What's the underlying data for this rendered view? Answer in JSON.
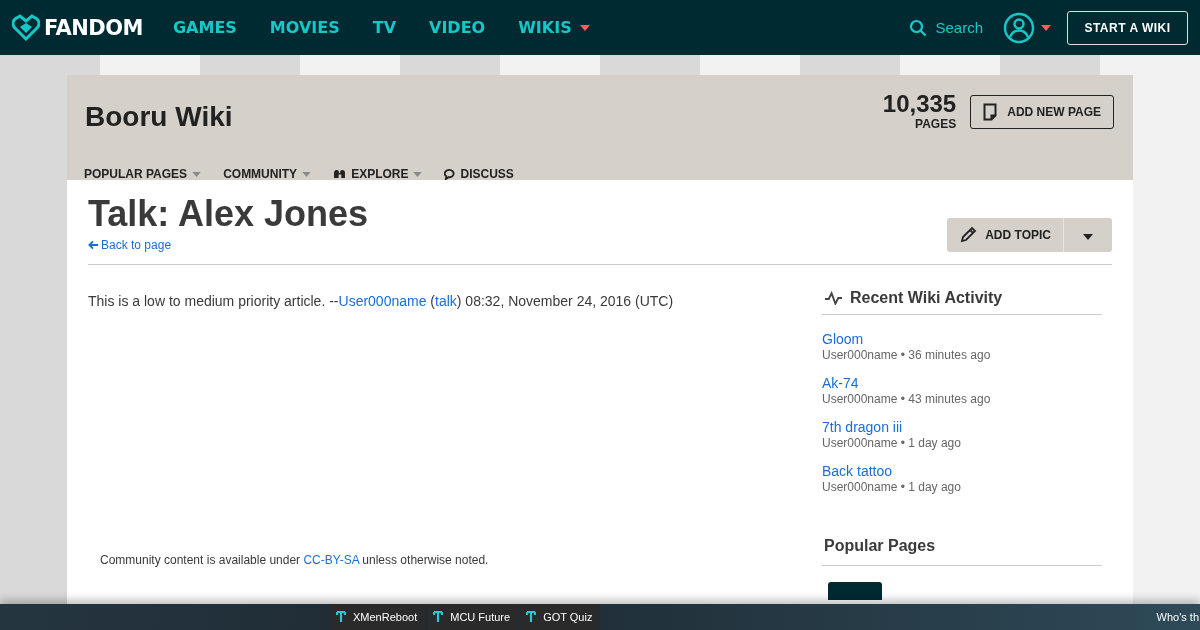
{
  "top_nav": {
    "logo": "FANDOM",
    "links": [
      {
        "label": "GAMES",
        "dropdown": false
      },
      {
        "label": "MOVIES",
        "dropdown": false
      },
      {
        "label": "TV",
        "dropdown": false
      },
      {
        "label": "VIDEO",
        "dropdown": false
      },
      {
        "label": "WIKIS",
        "dropdown": true
      }
    ],
    "search": "Search",
    "start_button": "START A WIKI"
  },
  "wiki_header": {
    "title": "Booru Wiki",
    "page_count": "10,335",
    "page_count_label": "PAGES",
    "add_button": "ADD NEW PAGE",
    "tabs": [
      {
        "label": "POPULAR PAGES",
        "kind": "menu",
        "dropdown": true
      },
      {
        "label": "COMMUNITY",
        "kind": "menu",
        "dropdown": true
      },
      {
        "label": "EXPLORE",
        "kind": "explore",
        "dropdown": true
      },
      {
        "label": "DISCUSS",
        "kind": "discuss",
        "dropdown": false
      }
    ]
  },
  "article": {
    "title": "Talk: Alex Jones",
    "back_link": "Back to page",
    "add_topic": "ADD TOPIC",
    "comment": {
      "text": "This is a low to medium priority article. --",
      "user": "User000name",
      "open_paren": " (",
      "talk": "talk",
      "rest": ") 08:32, November 24, 2016 (UTC)"
    },
    "license": {
      "before": "Community content is available under ",
      "link": "CC-BY-SA",
      "after": " unless otherwise noted."
    }
  },
  "recent_activity": {
    "title": "Recent Wiki Activity",
    "items": [
      {
        "page": "Gloom",
        "meta": "User000name • 36 minutes ago"
      },
      {
        "page": "Ak-74",
        "meta": "User000name • 43 minutes ago"
      },
      {
        "page": "7th dragon iii",
        "meta": "User000name • 1 day ago"
      },
      {
        "page": "Back tattoo",
        "meta": "User000name • 1 day ago"
      }
    ]
  },
  "popular_pages": {
    "title": "Popular Pages"
  },
  "bottom_bar": {
    "tabs": [
      "XMenReboot",
      "MCU Future",
      "GOT Quiz"
    ],
    "right_text": "Who's th"
  }
}
